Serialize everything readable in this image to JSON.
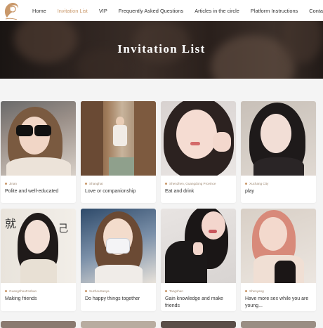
{
  "nav": {
    "items": [
      "Home",
      "Invitation List",
      "VIP",
      "Frequently Asked Questions",
      "Articles in the circle",
      "Platform Instructions",
      "Contact Us"
    ],
    "active_index": 1,
    "active_color": "#c9986a"
  },
  "hero": {
    "title": "Invitation List"
  },
  "cards": [
    {
      "city": "Jinan",
      "tag": "Polite and well-educated"
    },
    {
      "city": "Shanghai",
      "tag": "Love or companionship"
    },
    {
      "city": "Shenzhen, Guangdong Province",
      "tag": "Eat and drink"
    },
    {
      "city": "Xuchang City",
      "tag": "play"
    },
    {
      "city": "GuangzhouFoshan",
      "tag": "Making friends"
    },
    {
      "city": "SuzhouSanya",
      "tag": "Do happy things together"
    },
    {
      "city": "Tangshan",
      "tag": "Gain knowledge and make friends"
    },
    {
      "city": "Shenyang",
      "tag": "Have more sex while you are young..."
    }
  ]
}
